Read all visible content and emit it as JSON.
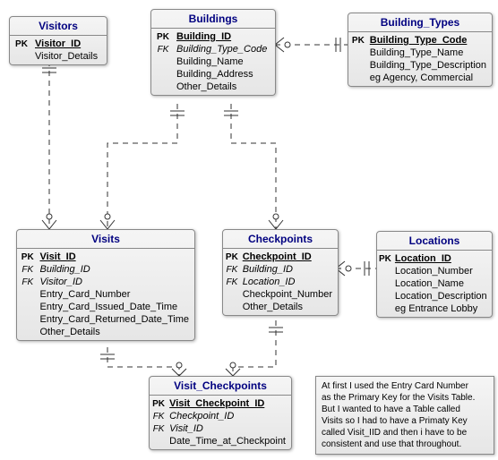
{
  "entities": {
    "visitors": {
      "title": "Visitors",
      "attrs": [
        {
          "key": "PK",
          "name": "Visitor_ID",
          "kind": "pk"
        },
        {
          "key": "",
          "name": "Visitor_Details",
          "kind": ""
        }
      ]
    },
    "buildings": {
      "title": "Buildings",
      "attrs": [
        {
          "key": "PK",
          "name": "Building_ID",
          "kind": "pk"
        },
        {
          "key": "FK",
          "name": "Building_Type_Code",
          "kind": "fk"
        },
        {
          "key": "",
          "name": "Building_Name",
          "kind": ""
        },
        {
          "key": "",
          "name": "Building_Address",
          "kind": ""
        },
        {
          "key": "",
          "name": "Other_Details",
          "kind": ""
        }
      ]
    },
    "building_types": {
      "title": "Building_Types",
      "attrs": [
        {
          "key": "PK",
          "name": "Building_Type_Code",
          "kind": "pk"
        },
        {
          "key": "",
          "name": "Building_Type_Name",
          "kind": ""
        },
        {
          "key": "",
          "name": "Building_Type_Description",
          "kind": ""
        },
        {
          "key": "",
          "name": "eg Agency, Commercial",
          "kind": ""
        }
      ]
    },
    "visits": {
      "title": "Visits",
      "attrs": [
        {
          "key": "PK",
          "name": "Visit_ID",
          "kind": "pk"
        },
        {
          "key": "FK",
          "name": "Building_ID",
          "kind": "fk"
        },
        {
          "key": "FK",
          "name": "Visitor_ID",
          "kind": "fk"
        },
        {
          "key": "",
          "name": "Entry_Card_Number",
          "kind": ""
        },
        {
          "key": "",
          "name": "Entry_Card_Issued_Date_Time",
          "kind": ""
        },
        {
          "key": "",
          "name": "Entry_Card_Returned_Date_Time",
          "kind": ""
        },
        {
          "key": "",
          "name": "Other_Details",
          "kind": ""
        }
      ]
    },
    "checkpoints": {
      "title": "Checkpoints",
      "attrs": [
        {
          "key": "PK",
          "name": "Checkpoint_ID",
          "kind": "pk"
        },
        {
          "key": "FK",
          "name": "Building_ID",
          "kind": "fk"
        },
        {
          "key": "FK",
          "name": "Location_ID",
          "kind": "fk"
        },
        {
          "key": "",
          "name": "Checkpoint_Number",
          "kind": ""
        },
        {
          "key": "",
          "name": "Other_Details",
          "kind": ""
        }
      ]
    },
    "locations": {
      "title": "Locations",
      "attrs": [
        {
          "key": "PK",
          "name": "Location_ID",
          "kind": "pk"
        },
        {
          "key": "",
          "name": "Location_Number",
          "kind": ""
        },
        {
          "key": "",
          "name": "Location_Name",
          "kind": ""
        },
        {
          "key": "",
          "name": "Location_Description",
          "kind": ""
        },
        {
          "key": "",
          "name": "eg Entrance Lobby",
          "kind": ""
        }
      ]
    },
    "visit_checkpoints": {
      "title": "Visit_Checkpoints",
      "attrs": [
        {
          "key": "PK",
          "name": "Visit_Checkpoint_ID",
          "kind": "pk"
        },
        {
          "key": "FK",
          "name": "Checkpoint_ID",
          "kind": "fk"
        },
        {
          "key": "FK",
          "name": "Visit_ID",
          "kind": "fk"
        },
        {
          "key": "",
          "name": "Date_Time_at_Checkpoint",
          "kind": ""
        }
      ]
    }
  },
  "note": {
    "line1": "At first I used the Entry Card Number",
    "line2": "as the Primary Key for the Visits Table.",
    "line3": "But I wanted to have a Table called",
    "line4": "Visits so I had to have a Primaty Key",
    "line5": "called Visit_IID and then i have to be",
    "line6": "consistent and use that throughout."
  },
  "chart_data": {
    "type": "table",
    "description": "Entity-Relationship Diagram",
    "entities": [
      "Visitors",
      "Buildings",
      "Building_Types",
      "Visits",
      "Checkpoints",
      "Locations",
      "Visit_Checkpoints"
    ],
    "relationships": [
      {
        "from": "Buildings",
        "to": "Building_Types",
        "via": "Building_Type_Code",
        "cardinality": "many-to-one"
      },
      {
        "from": "Visits",
        "to": "Visitors",
        "via": "Visitor_ID",
        "cardinality": "many-to-one"
      },
      {
        "from": "Visits",
        "to": "Buildings",
        "via": "Building_ID",
        "cardinality": "many-to-one"
      },
      {
        "from": "Checkpoints",
        "to": "Buildings",
        "via": "Building_ID",
        "cardinality": "many-to-one"
      },
      {
        "from": "Checkpoints",
        "to": "Locations",
        "via": "Location_ID",
        "cardinality": "many-to-one"
      },
      {
        "from": "Visit_Checkpoints",
        "to": "Visits",
        "via": "Visit_ID",
        "cardinality": "many-to-one"
      },
      {
        "from": "Visit_Checkpoints",
        "to": "Checkpoints",
        "via": "Checkpoint_ID",
        "cardinality": "many-to-one"
      }
    ]
  }
}
